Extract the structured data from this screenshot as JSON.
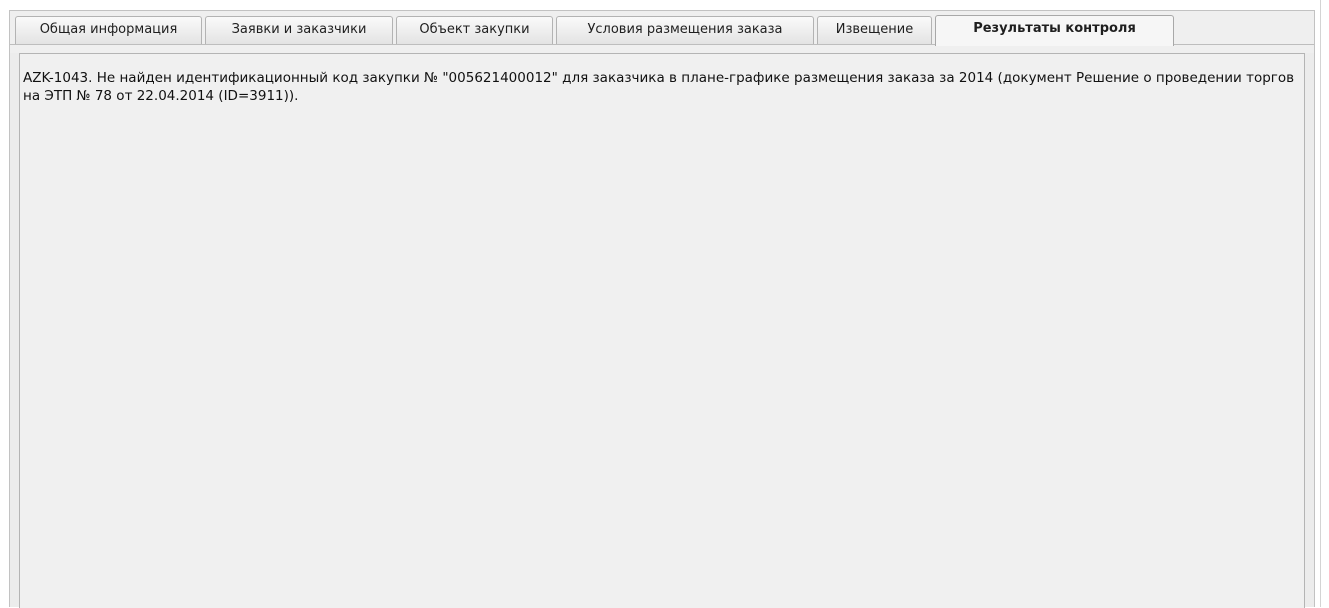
{
  "tabs": [
    {
      "label": "Общая информация",
      "active": false
    },
    {
      "label": "Заявки и заказчики",
      "active": false
    },
    {
      "label": "Объект закупки",
      "active": false
    },
    {
      "label": "Условия размещения заказа",
      "active": false
    },
    {
      "label": "Извещение",
      "active": false
    },
    {
      "label": "Результаты контроля",
      "active": true
    }
  ],
  "content": {
    "message": "AZK-1043. Не найден идентификационный код закупки № \"005621400012\" для заказчика в плане-графике размещения заказа за 2014 (документ Решение о проведении торгов на ЭТП № 78 от 22.04.2014 (ID=3911))."
  },
  "colors": {
    "panel_background": "#ececec",
    "content_background": "#f0f0f0",
    "border": "#b4b4b4",
    "text": "#111111"
  }
}
